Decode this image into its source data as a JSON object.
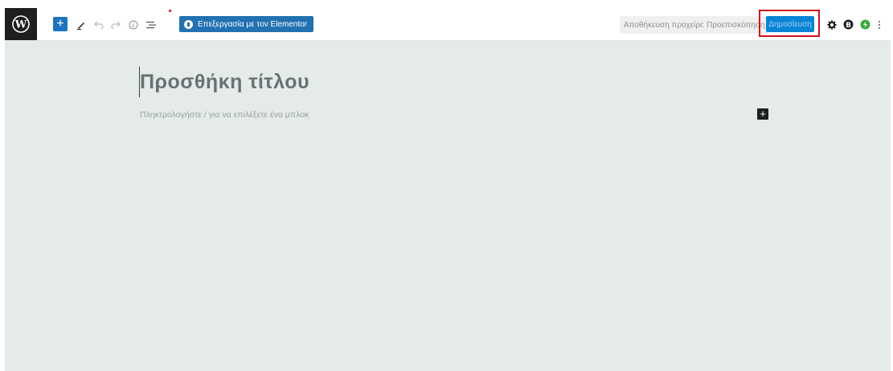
{
  "toolbar": {
    "edit_with_elementor": "Επεξεργασία με τον Elementor",
    "save_draft": "Αποθήκευση προχείρου",
    "preview": "Προεπισκόπηση",
    "publish": "Δημοσίευση",
    "icons": [
      "wordpress-logo",
      "add-block",
      "tools-pencil",
      "undo",
      "redo",
      "info",
      "list-view",
      "settings-gear",
      "plugin-b",
      "plugin-green",
      "more-options"
    ]
  },
  "editor": {
    "title_placeholder": "Προσθήκη τίτλου",
    "block_placeholder": "Πληκτρολογήστε / για να επιλέξετε ένα μπλοκ"
  },
  "colors": {
    "canvas_bg": "#e4ebe8",
    "primary": "#0a84d6",
    "highlight": "#d0101b"
  }
}
